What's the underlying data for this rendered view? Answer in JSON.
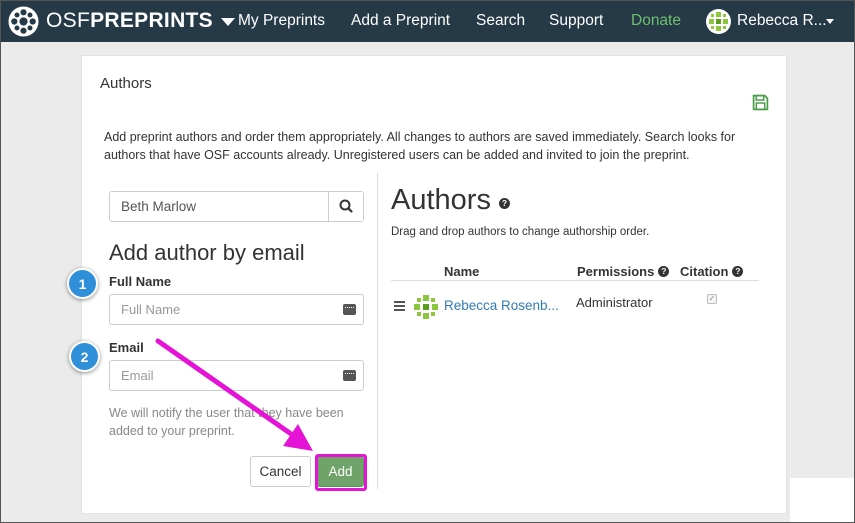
{
  "navbar": {
    "brand_prefix": "OSF",
    "brand_suffix": "PREPRINTS",
    "links": [
      "My Preprints",
      "Add a Preprint",
      "Search",
      "Support"
    ],
    "donate": "Donate",
    "user_name": "Rebecca R...",
    "icons": [
      "osf-logo-icon",
      "brand-dropdown-caret-icon",
      "user-avatar-icon",
      "user-dropdown-caret-icon"
    ],
    "colors": {
      "bar": "#263947",
      "donate": "#6cc06c"
    }
  },
  "section": {
    "heading": "Authors",
    "save_icon": "save-icon",
    "description": "Add preprint authors and order them appropriately. All changes to authors are saved immediately. Search looks for authors that have OSF accounts already. Unregistered users can be added and invited to join the preprint."
  },
  "search": {
    "value": "Beth Marlow",
    "icon": "search-icon"
  },
  "add_by_email": {
    "title": "Add author by email",
    "full_name_label": "Full Name",
    "full_name_placeholder": "Full Name",
    "email_label": "Email",
    "email_placeholder": "Email",
    "notify": "We will notify the user that they have been added to your preprint.",
    "cancel": "Cancel",
    "add": "Add",
    "add_color": "#6fa36a"
  },
  "authors_panel": {
    "title": "Authors",
    "drag_note": "Drag and drop authors to change authorship order.",
    "columns": [
      "Name",
      "Permissions",
      "Citation"
    ],
    "rows": [
      {
        "name": "Rebecca Rosenb...",
        "permission": "Administrator",
        "citation": true
      }
    ]
  },
  "annotations": {
    "steps": [
      "1",
      "2"
    ],
    "step_color": "#2f8fd8",
    "highlight_color": "#e513d6"
  }
}
